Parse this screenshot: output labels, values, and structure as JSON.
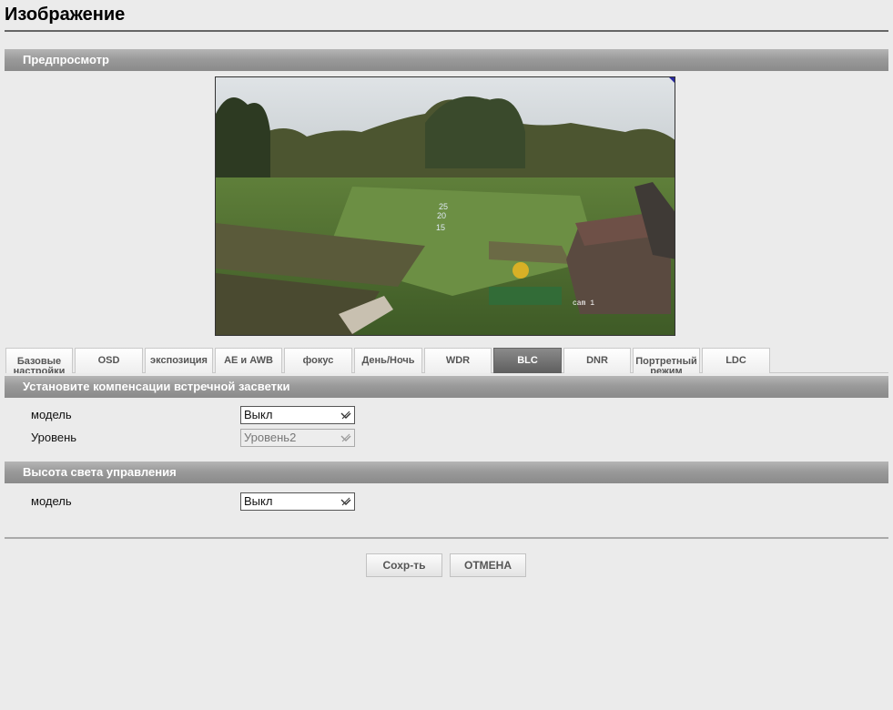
{
  "page": {
    "title": "Изображение"
  },
  "preview": {
    "heading": "Предпросмотр",
    "overlay_numbers": [
      "25",
      "20",
      "15"
    ],
    "camera_label": "cam 1"
  },
  "tabs": [
    {
      "label": "Базовые настройки",
      "active": false
    },
    {
      "label": "OSD",
      "active": false
    },
    {
      "label": "экспозиция",
      "active": false
    },
    {
      "label": "AE и AWB",
      "active": false
    },
    {
      "label": "фокус",
      "active": false
    },
    {
      "label": "День/Ночь",
      "active": false
    },
    {
      "label": "WDR",
      "active": false
    },
    {
      "label": "BLC",
      "active": true
    },
    {
      "label": "DNR",
      "active": false
    },
    {
      "label": "Портретный режим",
      "active": false
    },
    {
      "label": "LDC",
      "active": false
    }
  ],
  "blc": {
    "heading": "Установите компенсации встречной засветки",
    "mode_label": "модель",
    "mode_value": "Выкл",
    "level_label": "Уровень",
    "level_value": "Уровень2"
  },
  "hlc": {
    "heading": "Высота света управления",
    "mode_label": "модель",
    "mode_value": "Выкл"
  },
  "actions": {
    "save_label": "Сохр-ть",
    "cancel_label": "ОТМЕНА"
  },
  "colors": {
    "active_tab": "#666666",
    "section_bar": "#9a9a9a",
    "background": "#ebebeb"
  }
}
